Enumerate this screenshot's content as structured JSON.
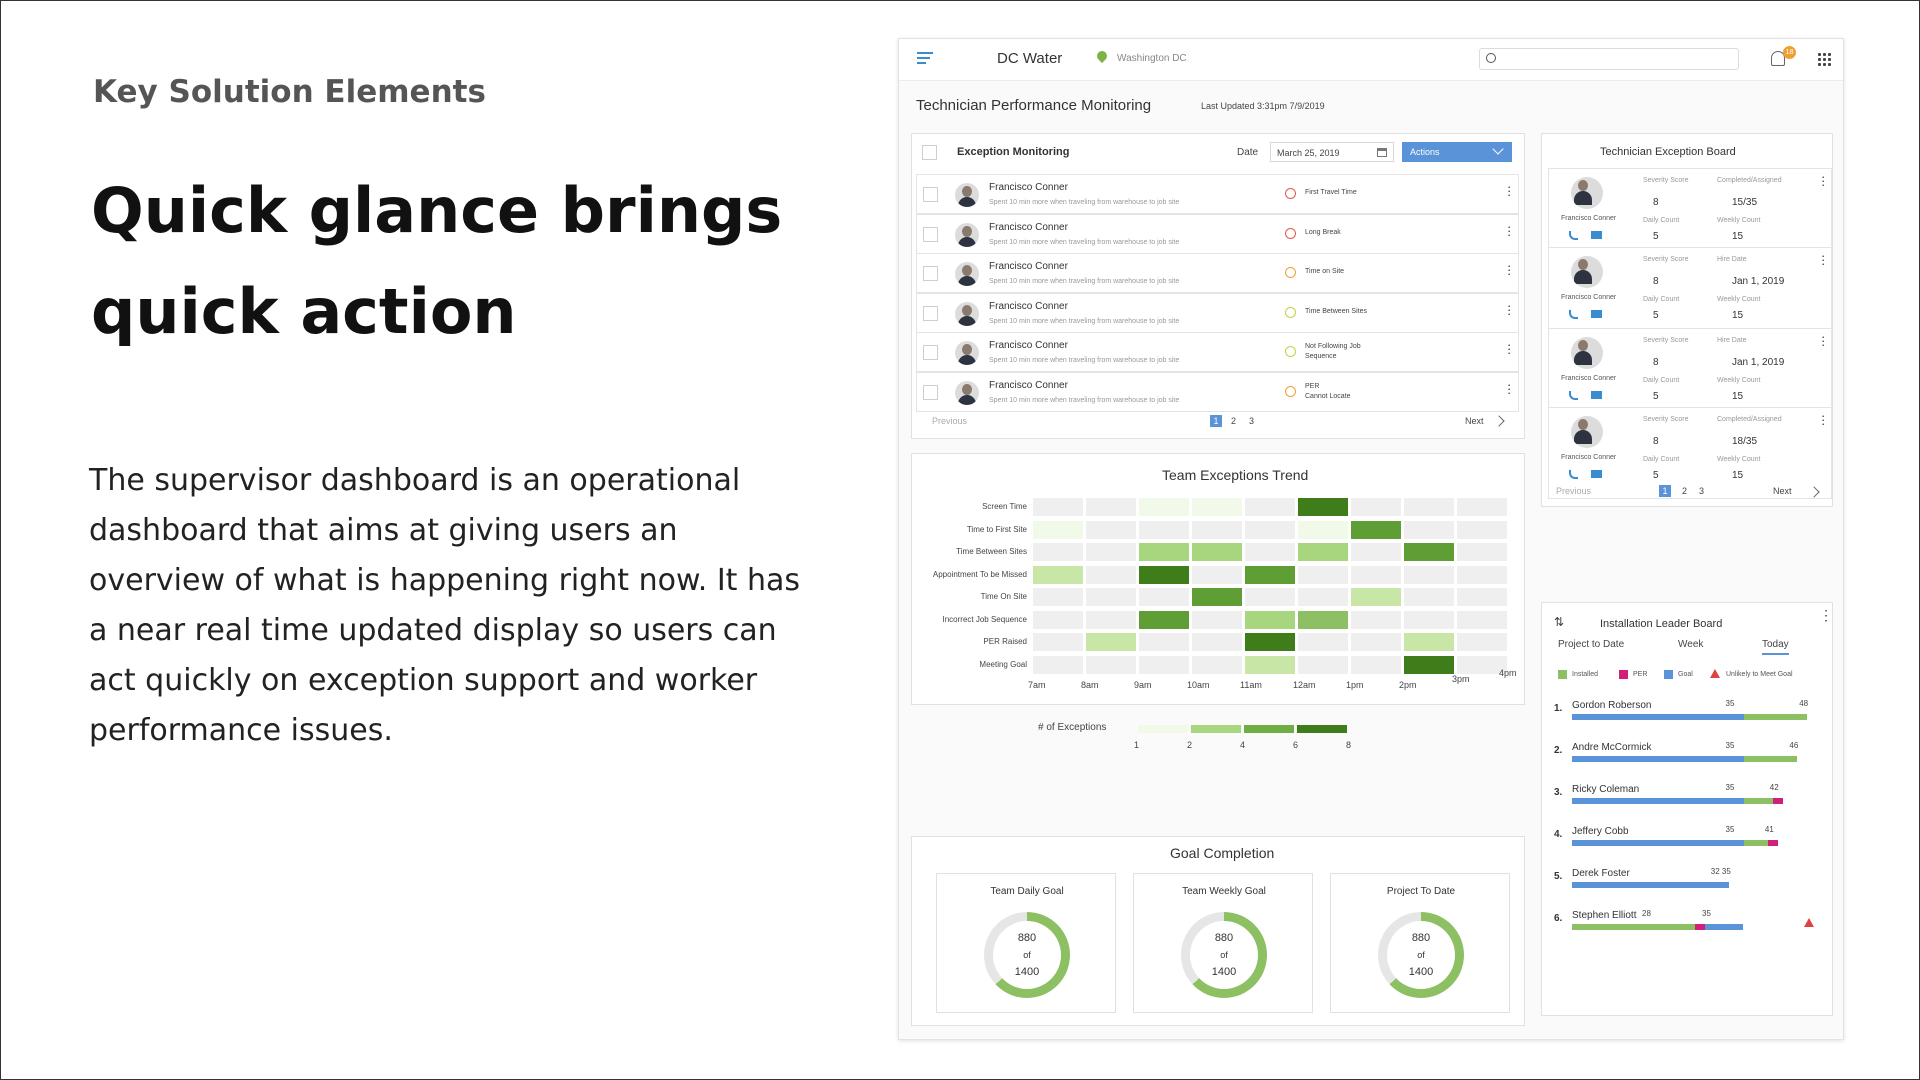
{
  "slide": {
    "eyebrow": "Key Solution Elements",
    "headline": "Quick glance brings quick action",
    "description": "The supervisor dashboard is an operational dashboard that aims at giving users an overview of what is happening right now. It has a near real time updated display so users can act quickly on exception support and worker performance issues."
  },
  "topbar": {
    "app": "DC Water",
    "location": "Washington DC",
    "badge": "18"
  },
  "page": {
    "title": "Technician Performance Monitoring",
    "updated": "Last Updated 3:31pm  7/9/2019"
  },
  "exceptions": {
    "title": "Exception Monitoring",
    "date_label": "Date",
    "date_value": "March 25, 2019",
    "actions": "Actions",
    "rows": [
      {
        "name": "Francisco Conner",
        "desc": "Spent 10 min more when traveling from warehouse to job site",
        "type": "First Travel Time",
        "type2": "",
        "icon": "car-icon",
        "color": "#e05a4a"
      },
      {
        "name": "Francisco Conner",
        "desc": "Spent 10 min more when traveling from warehouse to job site",
        "type": "Long Break",
        "type2": "",
        "icon": "coffee-icon",
        "color": "#e05a4a"
      },
      {
        "name": "Francisco Conner",
        "desc": "Spent 10 min more when traveling from warehouse to job site",
        "type": "Time on Site",
        "type2": "",
        "icon": "clock-icon",
        "color": "#f0a030"
      },
      {
        "name": "Francisco Conner",
        "desc": "Spent 10 min more when traveling from warehouse to job site",
        "type": "Time Between Sites",
        "type2": "",
        "icon": "clock-icon",
        "color": "#c8d040"
      },
      {
        "name": "Francisco Conner",
        "desc": "Spent 10 min more when traveling from warehouse to job site",
        "type": "Not Following Job",
        "type2": "Sequence",
        "icon": "route-icon",
        "color": "#c8d040"
      },
      {
        "name": "Francisco Conner",
        "desc": "Spent 10 min more when traveling from warehouse to job site",
        "type": "PER",
        "type2": "Cannot Locate",
        "icon": "alert-circle-icon",
        "color": "#f0a030"
      }
    ],
    "pager": {
      "prev": "Previous",
      "next": "Next",
      "pages": [
        "1",
        "2",
        "3"
      ]
    }
  },
  "board": {
    "title": "Technician Exception Board",
    "cards": [
      {
        "name": "Francisco Conner",
        "l1": "Severity Score",
        "v1": "8",
        "l2": "Completed/Assigned",
        "v2": "15/35",
        "l3": "Daily Count",
        "v3": "5",
        "l4": "Weekly Count",
        "v4": "15"
      },
      {
        "name": "Francisco Conner",
        "l1": "Severity Score",
        "v1": "8",
        "l2": "Hire Date",
        "v2": "Jan 1, 2019",
        "l3": "Daily Count",
        "v3": "5",
        "l4": "Weekly Count",
        "v4": "15"
      },
      {
        "name": "Francisco Conner",
        "l1": "Severity Score",
        "v1": "8",
        "l2": "Hire Date",
        "v2": "Jan 1, 2019",
        "l3": "Daily Count",
        "v3": "5",
        "l4": "Weekly Count",
        "v4": "15"
      },
      {
        "name": "Francisco Conner",
        "l1": "Severity Score",
        "v1": "8",
        "l2": "Completed/Assigned",
        "v2": "18/35",
        "l3": "Daily Count",
        "v3": "5",
        "l4": "Weekly Count",
        "v4": "15"
      }
    ],
    "pager": {
      "prev": "Previous",
      "next": "Next",
      "pages": [
        "1",
        "2",
        "3"
      ]
    }
  },
  "chart_data": {
    "type": "heatmap",
    "title": "Team Exceptions Trend",
    "rows": [
      "Screen Time",
      "Time to First Site",
      "Time Between Sites",
      "Appointment To be Missed",
      "Time On Site",
      "Incorrect Job Sequence",
      "PER Raised",
      "Meeting Goal"
    ],
    "x_ticks": [
      "7am",
      "8am",
      "9am",
      "10am",
      "11am",
      "12am",
      "1pm",
      "2pm",
      "3pm",
      "4pm"
    ],
    "values": [
      [
        0,
        0,
        1,
        1,
        0,
        8,
        0,
        0,
        0
      ],
      [
        1,
        0,
        0,
        0,
        0,
        1,
        6,
        0,
        0
      ],
      [
        0,
        0,
        3,
        3,
        0,
        3,
        0,
        6,
        0
      ],
      [
        2,
        0,
        8,
        0,
        6,
        0,
        0,
        0,
        0
      ],
      [
        0,
        0,
        0,
        6,
        0,
        0,
        2,
        0,
        0
      ],
      [
        0,
        0,
        6,
        0,
        3,
        4,
        0,
        0,
        0
      ],
      [
        0,
        2,
        0,
        0,
        8,
        0,
        0,
        2,
        0
      ],
      [
        0,
        0,
        0,
        0,
        2,
        0,
        0,
        8,
        0
      ]
    ],
    "legend_title": "# of Exceptions",
    "legend_ticks": [
      "1",
      "2",
      "4",
      "6",
      "8"
    ]
  },
  "goals": {
    "title": "Goal Completion",
    "items": [
      {
        "label": "Team Daily Goal",
        "value": "880",
        "of": "of",
        "total": "1400",
        "fraction": 0.63
      },
      {
        "label": "Team Weekly Goal",
        "value": "880",
        "of": "of",
        "total": "1400",
        "fraction": 0.63
      },
      {
        "label": "Project To Date",
        "value": "880",
        "of": "of",
        "total": "1400",
        "fraction": 0.63
      }
    ]
  },
  "leaders": {
    "title": "Installation Leader Board",
    "tabs": [
      "Project to Date",
      "Week",
      "Today"
    ],
    "legend": [
      "Installed",
      "PER",
      "Goal",
      "Unlikely to Meet Goal"
    ],
    "rows": [
      {
        "rank": "1.",
        "name": "Gordon Roberson",
        "goal_label": "35",
        "total_label": "48",
        "blue": 35,
        "green": 13,
        "pink": 0,
        "warn": false
      },
      {
        "rank": "2.",
        "name": "Andre McCormick",
        "goal_label": "35",
        "total_label": "46",
        "blue": 35,
        "green": 11,
        "pink": 0,
        "warn": false
      },
      {
        "rank": "3.",
        "name": "Ricky Coleman",
        "goal_label": "35",
        "total_label": "42",
        "blue": 35,
        "green": 6,
        "pink": 1,
        "warn": false
      },
      {
        "rank": "4.",
        "name": "Jeffery Cobb",
        "goal_label": "35",
        "total_label": "41",
        "blue": 35,
        "green": 5,
        "pink": 1,
        "warn": false
      },
      {
        "rank": "5.",
        "name": "Derek Foster",
        "goal_label": "32  35",
        "total_label": "",
        "blue": 32,
        "green": 0,
        "pink": 0,
        "warn": false
      },
      {
        "rank": "6.",
        "name": "Stephen Elliott",
        "goal_label": "28",
        "total_label": "35",
        "blue": 0,
        "green": 0,
        "pink": 0,
        "warn": true
      }
    ],
    "colors": {
      "installed": "#8cc063",
      "per": "#d0207a",
      "goal": "#5b93d8",
      "warn": "#e04040"
    }
  }
}
